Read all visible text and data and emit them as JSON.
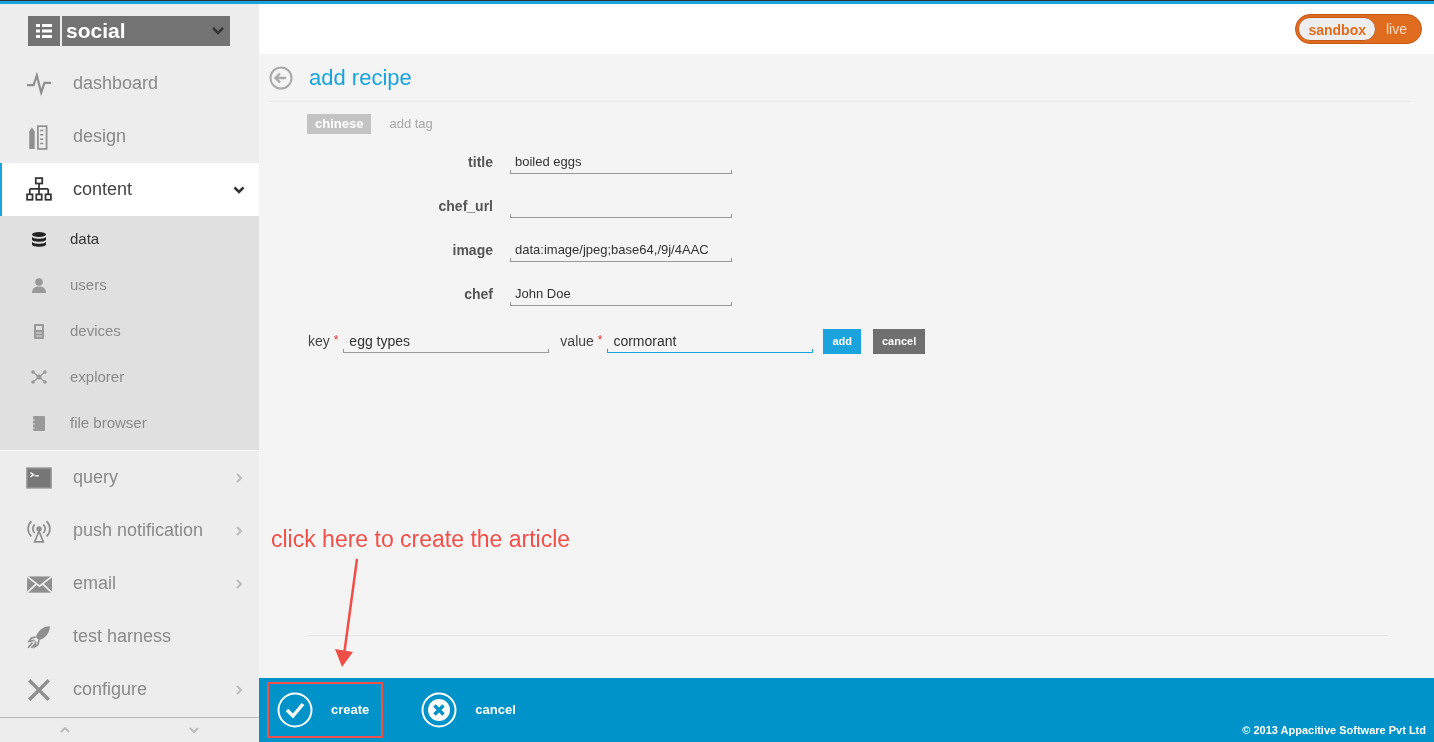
{
  "app_selector": {
    "value": "social"
  },
  "nav": [
    {
      "label": "dashboard",
      "kind": "link",
      "selected": false
    },
    {
      "label": "design",
      "kind": "link",
      "selected": false
    },
    {
      "label": "content",
      "kind": "group",
      "selected": true,
      "expanded": true,
      "children": [
        {
          "label": "data",
          "selected": true
        },
        {
          "label": "users",
          "selected": false
        },
        {
          "label": "devices",
          "selected": false
        },
        {
          "label": "explorer",
          "selected": false
        },
        {
          "label": "file browser",
          "selected": false
        }
      ]
    },
    {
      "label": "query",
      "kind": "group",
      "selected": false,
      "expanded": false
    },
    {
      "label": "push notification",
      "kind": "group",
      "selected": false,
      "expanded": false
    },
    {
      "label": "email",
      "kind": "group",
      "selected": false,
      "expanded": false
    },
    {
      "label": "test harness",
      "kind": "link",
      "selected": false
    },
    {
      "label": "configure",
      "kind": "group",
      "selected": false,
      "expanded": false
    }
  ],
  "environment": [
    {
      "label": "sandbox",
      "selected": true
    },
    {
      "label": "live",
      "selected": false
    }
  ],
  "page_title": "add recipe",
  "tags": [
    {
      "label": "chinese"
    }
  ],
  "tag_input": {
    "placeholder": "add tag"
  },
  "fields": [
    {
      "label": "title",
      "value": "boiled eggs"
    },
    {
      "label": "chef_url"
    },
    {
      "label": "image",
      "value": "data:image/jpeg;base64,/9j/4AAC"
    },
    {
      "label": "chef",
      "value": "John Doe"
    }
  ],
  "attribute": {
    "key_label": "key",
    "key_required": "*",
    "key_value": "egg types",
    "key_focused": false,
    "value_label": "value",
    "value_required": "*",
    "value_value": "cormorant",
    "value_focused": true,
    "add_button": "add",
    "cancel_button": "cancel"
  },
  "annotation": {
    "text": "click here to create the article"
  },
  "footer_actions": [
    {
      "label": "create",
      "kind": "confirm",
      "highlighted": true
    },
    {
      "label": "cancel",
      "kind": "cancel",
      "highlighted": false
    }
  ],
  "copyright": "© 2013 Appacitive Software Pvt Ltd"
}
